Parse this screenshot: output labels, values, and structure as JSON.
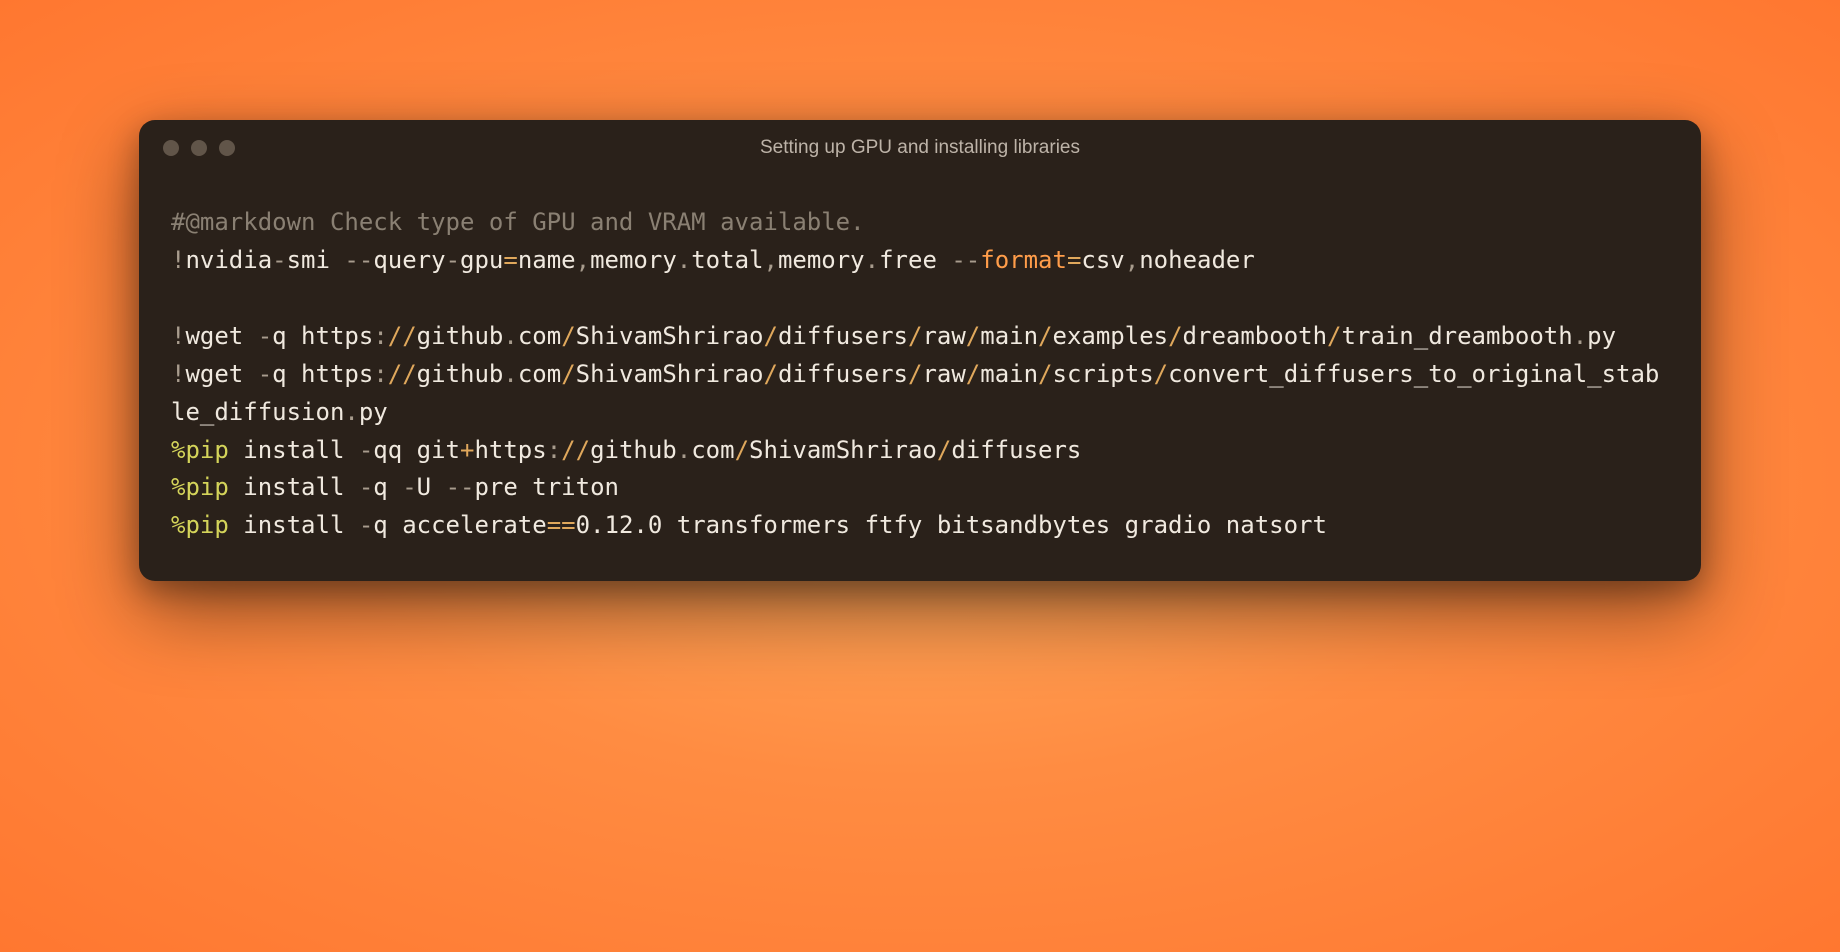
{
  "window": {
    "title": "Setting up GPU and installing libraries"
  },
  "code": {
    "lines": [
      {
        "type": "text",
        "tokens": [
          {
            "cls": "c-comment",
            "text": "#@markdown Check type of GPU and VRAM available."
          }
        ]
      },
      {
        "type": "text",
        "tokens": [
          {
            "cls": "c-punct",
            "text": "!"
          },
          {
            "cls": "c-default",
            "text": "nvidia"
          },
          {
            "cls": "c-punct",
            "text": "-"
          },
          {
            "cls": "c-default",
            "text": "smi "
          },
          {
            "cls": "c-punct",
            "text": "--"
          },
          {
            "cls": "c-default",
            "text": "query"
          },
          {
            "cls": "c-punct",
            "text": "-"
          },
          {
            "cls": "c-default",
            "text": "gpu"
          },
          {
            "cls": "c-operator",
            "text": "="
          },
          {
            "cls": "c-default",
            "text": "name"
          },
          {
            "cls": "c-punct",
            "text": ","
          },
          {
            "cls": "c-default",
            "text": "memory"
          },
          {
            "cls": "c-punct",
            "text": "."
          },
          {
            "cls": "c-default",
            "text": "total"
          },
          {
            "cls": "c-punct",
            "text": ","
          },
          {
            "cls": "c-default",
            "text": "memory"
          },
          {
            "cls": "c-punct",
            "text": "."
          },
          {
            "cls": "c-default",
            "text": "free "
          },
          {
            "cls": "c-punct",
            "text": "--"
          },
          {
            "cls": "c-keyword",
            "text": "format"
          },
          {
            "cls": "c-operator",
            "text": "="
          },
          {
            "cls": "c-default",
            "text": "csv"
          },
          {
            "cls": "c-punct",
            "text": ","
          },
          {
            "cls": "c-default",
            "text": "noheader"
          }
        ]
      },
      {
        "type": "blank"
      },
      {
        "type": "text",
        "tokens": [
          {
            "cls": "c-punct",
            "text": "!"
          },
          {
            "cls": "c-default",
            "text": "wget "
          },
          {
            "cls": "c-punct",
            "text": "-"
          },
          {
            "cls": "c-default",
            "text": "q https"
          },
          {
            "cls": "c-punct",
            "text": ":"
          },
          {
            "cls": "c-operator",
            "text": "//"
          },
          {
            "cls": "c-default",
            "text": "github"
          },
          {
            "cls": "c-punct",
            "text": "."
          },
          {
            "cls": "c-default",
            "text": "com"
          },
          {
            "cls": "c-operator",
            "text": "/"
          },
          {
            "cls": "c-default",
            "text": "ShivamShrirao"
          },
          {
            "cls": "c-operator",
            "text": "/"
          },
          {
            "cls": "c-default",
            "text": "diffusers"
          },
          {
            "cls": "c-operator",
            "text": "/"
          },
          {
            "cls": "c-default",
            "text": "raw"
          },
          {
            "cls": "c-operator",
            "text": "/"
          },
          {
            "cls": "c-default",
            "text": "main"
          },
          {
            "cls": "c-operator",
            "text": "/"
          },
          {
            "cls": "c-default",
            "text": "examples"
          },
          {
            "cls": "c-operator",
            "text": "/"
          },
          {
            "cls": "c-default",
            "text": "dreambooth"
          },
          {
            "cls": "c-operator",
            "text": "/"
          },
          {
            "cls": "c-default",
            "text": "train_dreambooth"
          },
          {
            "cls": "c-punct",
            "text": "."
          },
          {
            "cls": "c-default",
            "text": "py"
          }
        ]
      },
      {
        "type": "text",
        "tokens": [
          {
            "cls": "c-punct",
            "text": "!"
          },
          {
            "cls": "c-default",
            "text": "wget "
          },
          {
            "cls": "c-punct",
            "text": "-"
          },
          {
            "cls": "c-default",
            "text": "q https"
          },
          {
            "cls": "c-punct",
            "text": ":"
          },
          {
            "cls": "c-operator",
            "text": "//"
          },
          {
            "cls": "c-default",
            "text": "github"
          },
          {
            "cls": "c-punct",
            "text": "."
          },
          {
            "cls": "c-default",
            "text": "com"
          },
          {
            "cls": "c-operator",
            "text": "/"
          },
          {
            "cls": "c-default",
            "text": "ShivamShrirao"
          },
          {
            "cls": "c-operator",
            "text": "/"
          },
          {
            "cls": "c-default",
            "text": "diffusers"
          },
          {
            "cls": "c-operator",
            "text": "/"
          },
          {
            "cls": "c-default",
            "text": "raw"
          },
          {
            "cls": "c-operator",
            "text": "/"
          },
          {
            "cls": "c-default",
            "text": "main"
          },
          {
            "cls": "c-operator",
            "text": "/"
          },
          {
            "cls": "c-default",
            "text": "scripts"
          },
          {
            "cls": "c-operator",
            "text": "/"
          },
          {
            "cls": "c-default",
            "text": "convert_diffusers_to_original_stable_diffusion"
          },
          {
            "cls": "c-punct",
            "text": "."
          },
          {
            "cls": "c-default",
            "text": "py"
          }
        ]
      },
      {
        "type": "text",
        "tokens": [
          {
            "cls": "c-magic",
            "text": "%pip"
          },
          {
            "cls": "c-default",
            "text": " install "
          },
          {
            "cls": "c-punct",
            "text": "-"
          },
          {
            "cls": "c-default",
            "text": "qq git"
          },
          {
            "cls": "c-operator",
            "text": "+"
          },
          {
            "cls": "c-default",
            "text": "https"
          },
          {
            "cls": "c-punct",
            "text": ":"
          },
          {
            "cls": "c-operator",
            "text": "//"
          },
          {
            "cls": "c-default",
            "text": "github"
          },
          {
            "cls": "c-punct",
            "text": "."
          },
          {
            "cls": "c-default",
            "text": "com"
          },
          {
            "cls": "c-operator",
            "text": "/"
          },
          {
            "cls": "c-default",
            "text": "ShivamShrirao"
          },
          {
            "cls": "c-operator",
            "text": "/"
          },
          {
            "cls": "c-default",
            "text": "diffusers"
          }
        ]
      },
      {
        "type": "text",
        "tokens": [
          {
            "cls": "c-magic",
            "text": "%pip"
          },
          {
            "cls": "c-default",
            "text": " install "
          },
          {
            "cls": "c-punct",
            "text": "-"
          },
          {
            "cls": "c-default",
            "text": "q "
          },
          {
            "cls": "c-punct",
            "text": "-"
          },
          {
            "cls": "c-default",
            "text": "U "
          },
          {
            "cls": "c-punct",
            "text": "--"
          },
          {
            "cls": "c-default",
            "text": "pre triton"
          }
        ]
      },
      {
        "type": "text",
        "tokens": [
          {
            "cls": "c-magic",
            "text": "%pip"
          },
          {
            "cls": "c-default",
            "text": " install "
          },
          {
            "cls": "c-punct",
            "text": "-"
          },
          {
            "cls": "c-default",
            "text": "q accelerate"
          },
          {
            "cls": "c-operator",
            "text": "=="
          },
          {
            "cls": "c-default",
            "text": "0.12.0 transformers ftfy bitsandbytes gradio natsort"
          }
        ]
      }
    ]
  }
}
